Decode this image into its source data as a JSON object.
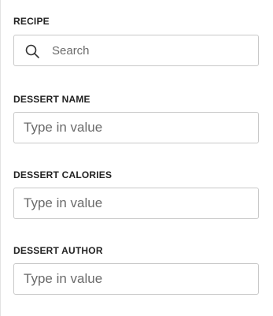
{
  "form": {
    "recipe": {
      "label": "RECIPE",
      "placeholder": "Search",
      "value": "",
      "icon": "search-icon"
    },
    "dessert_name": {
      "label": "DESSERT NAME",
      "placeholder": "Type in value",
      "value": ""
    },
    "dessert_calories": {
      "label": "DESSERT CALORIES",
      "placeholder": "Type in value",
      "value": ""
    },
    "dessert_author": {
      "label": "DESSERT AUTHOR",
      "placeholder": "Type in value",
      "value": ""
    }
  },
  "colors": {
    "border": "#c8c8c8",
    "label": "#222222",
    "placeholder": "#6b6b6b",
    "panel_divider": "#e3e3e3"
  }
}
